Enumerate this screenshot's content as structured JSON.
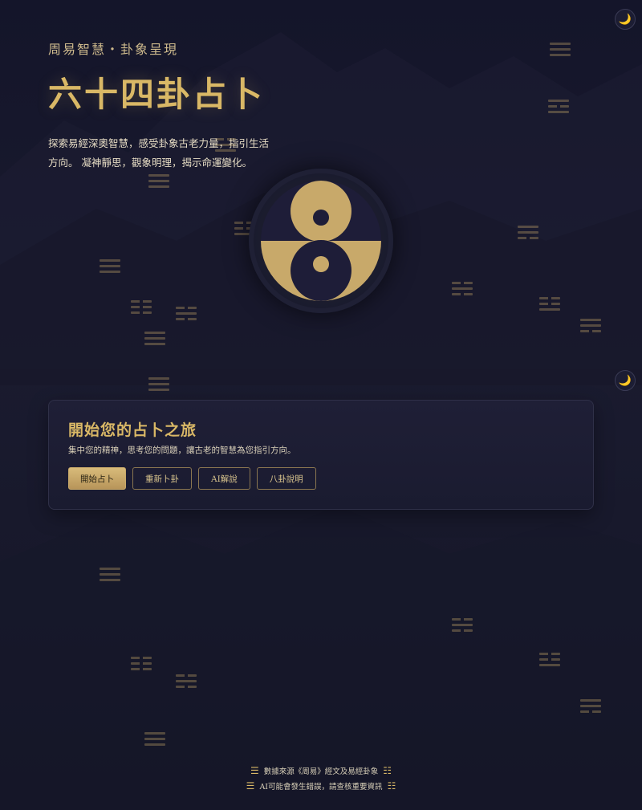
{
  "hero": {
    "subtitle": "周易智慧・卦象呈現",
    "title": "六十四卦占卜",
    "description": "探索易經深奧智慧，感受卦象古老力量，指引生活方向。 凝神靜思，觀象明理，揭示命運變化。"
  },
  "theme_toggle": {
    "icon": "moon-icon",
    "glyph": "🌙"
  },
  "panel": {
    "title": "開始您的占卜之旅",
    "text": "集中您的精神，思考您的問題，讓古老的智慧為您指引方向。",
    "buttons": {
      "start": "開始占卜",
      "redo": "重新卜卦",
      "ai": "AI解說",
      "bagua": "八卦說明"
    }
  },
  "footer": {
    "line1": "數據來源《周易》經文及易經卦象",
    "line2": "AI可能會發生錯誤，請查核重要資訊",
    "icon_left": "☰",
    "icon_right": "☷"
  },
  "colors": {
    "accent": "#d9b866",
    "background": "#1a1b2f",
    "panel": "#1f1f36"
  }
}
